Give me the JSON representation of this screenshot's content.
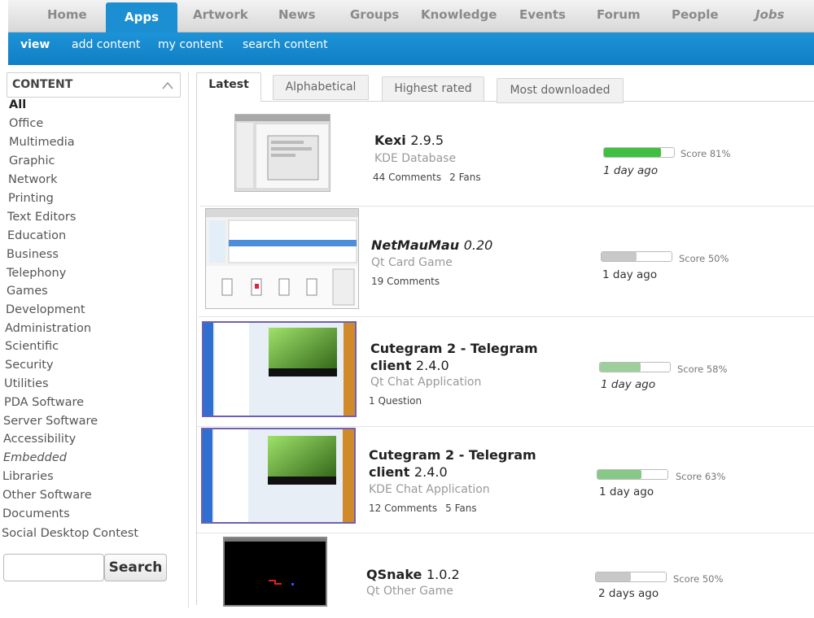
{
  "nav": {
    "tabs": [
      "Home",
      "Apps",
      "Artwork",
      "News",
      "Groups",
      "Knowledge",
      "Events",
      "Forum",
      "People",
      "Jobs"
    ],
    "active_tab": "Apps",
    "subtabs": [
      "view",
      "add content",
      "my content",
      "search content"
    ],
    "active_subtab": "view"
  },
  "sidebar": {
    "header": "CONTENT",
    "categories": [
      "All",
      "Office",
      "Multimedia",
      "Graphic",
      "Network",
      "Printing",
      "Text Editors",
      "Education",
      "Business",
      "Telephony",
      "Games",
      "Development",
      "Administration",
      "Scientific",
      "Security",
      "Utilities",
      "PDA Software",
      "Server Software",
      "Accessibility",
      "Embedded",
      "Libraries",
      "Other Software",
      "Documents",
      "Social Desktop Contest"
    ],
    "active_category": "All",
    "search_placeholder": "",
    "search_button": "Search"
  },
  "sort_tabs": [
    "Latest",
    "Alphabetical",
    "Highest rated",
    "Most downloaded"
  ],
  "active_sort": "Latest",
  "items": [
    {
      "name": "Kexi",
      "version": "2.9.5",
      "subtitle": "KDE Database",
      "meta": [
        "44 Comments",
        "2 Fans"
      ],
      "score_label": "Score 81%",
      "score": 81,
      "bar_color": "#3fbf3f",
      "date": "1 day ago",
      "italic_title": false
    },
    {
      "name": "NetMauMau",
      "version": "0.20",
      "subtitle": "Qt Card Game",
      "meta": [
        "19 Comments"
      ],
      "score_label": "Score 50%",
      "score": 50,
      "bar_color": "#c8c8c8",
      "date": "1 day ago",
      "italic_title": true
    },
    {
      "name": "Cutegram 2 - Telegram client",
      "version": "2.4.0",
      "subtitle": "Qt Chat Application",
      "meta": [
        "1 Question"
      ],
      "score_label": "Score 58%",
      "score": 58,
      "bar_color": "#9ccf9c",
      "date": "1 day ago",
      "italic_title": false
    },
    {
      "name": "Cutegram 2 - Telegram client",
      "version": "2.4.0",
      "subtitle": "KDE Chat Application",
      "meta": [
        "12 Comments",
        "5 Fans"
      ],
      "score_label": "Score 63%",
      "score": 63,
      "bar_color": "#86c886",
      "date": "1 day ago",
      "italic_title": false
    },
    {
      "name": "QSnake",
      "version": "1.0.2",
      "subtitle": "Qt Other Game",
      "meta": [],
      "score_label": "Score 50%",
      "score": 50,
      "bar_color": "#c8c8c8",
      "date": "2 days ago",
      "italic_title": false
    }
  ]
}
